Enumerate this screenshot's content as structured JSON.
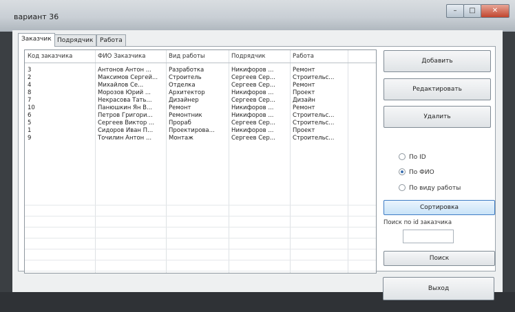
{
  "window": {
    "title": "вариант 36",
    "minimize_glyph": "–",
    "maximize_glyph": "□",
    "close_glyph": "✕"
  },
  "tabs": [
    {
      "label": "Заказчик",
      "active": true
    },
    {
      "label": "Подрядчик",
      "active": false
    },
    {
      "label": "Работа",
      "active": false
    }
  ],
  "table": {
    "columns": [
      "Код заказчика",
      "ФИО Заказчика",
      "Вид работы",
      "Подрядчик",
      "Работа"
    ],
    "rows": [
      [
        "3",
        "Антонов Антон ...",
        "Разработка",
        "Никифоров ...",
        "Ремонт"
      ],
      [
        "2",
        "Максимов Сергей...",
        "Строитель",
        "Сергеев Сер...",
        "Строительс..."
      ],
      [
        "4",
        "Михайлов Се...",
        "Отделка",
        "Сергеев Сер...",
        "Ремонт"
      ],
      [
        "8",
        "Морозов Юрий ...",
        "Архитектор",
        "Никифоров ...",
        "Проект"
      ],
      [
        "7",
        "Некрасова Тать...",
        "Дизайнер",
        "Сергеев Сер...",
        "Дизайн"
      ],
      [
        "10",
        "Панюшкин Ян В...",
        "Ремонт",
        "Никифоров ...",
        "Ремонт"
      ],
      [
        "6",
        "Петров Григори...",
        "Ремонтник",
        "Никифоров ...",
        "Строительс..."
      ],
      [
        "5",
        "Сергеев Виктор ...",
        "Прораб",
        "Сергеев Сер...",
        "Строительс..."
      ],
      [
        "1",
        "Сидоров Иван П...",
        "Проектирова...",
        "Никифоров ...",
        "Проект"
      ],
      [
        "9",
        "Точилин Антон ...",
        "Монтаж",
        "Сергеев Сер...",
        "Строительс..."
      ]
    ]
  },
  "buttons": {
    "add": "Добавить",
    "edit": "Редактировать",
    "delete": "Удалить",
    "sort": "Сортировка",
    "search": "Поиск",
    "exit": "Выход"
  },
  "sort_options": [
    {
      "label": "По ID",
      "checked": false
    },
    {
      "label": "По ФИО",
      "checked": true
    },
    {
      "label": "По виду работы",
      "checked": false
    }
  ],
  "search": {
    "label": "Поиск по id заказчика",
    "value": ""
  }
}
